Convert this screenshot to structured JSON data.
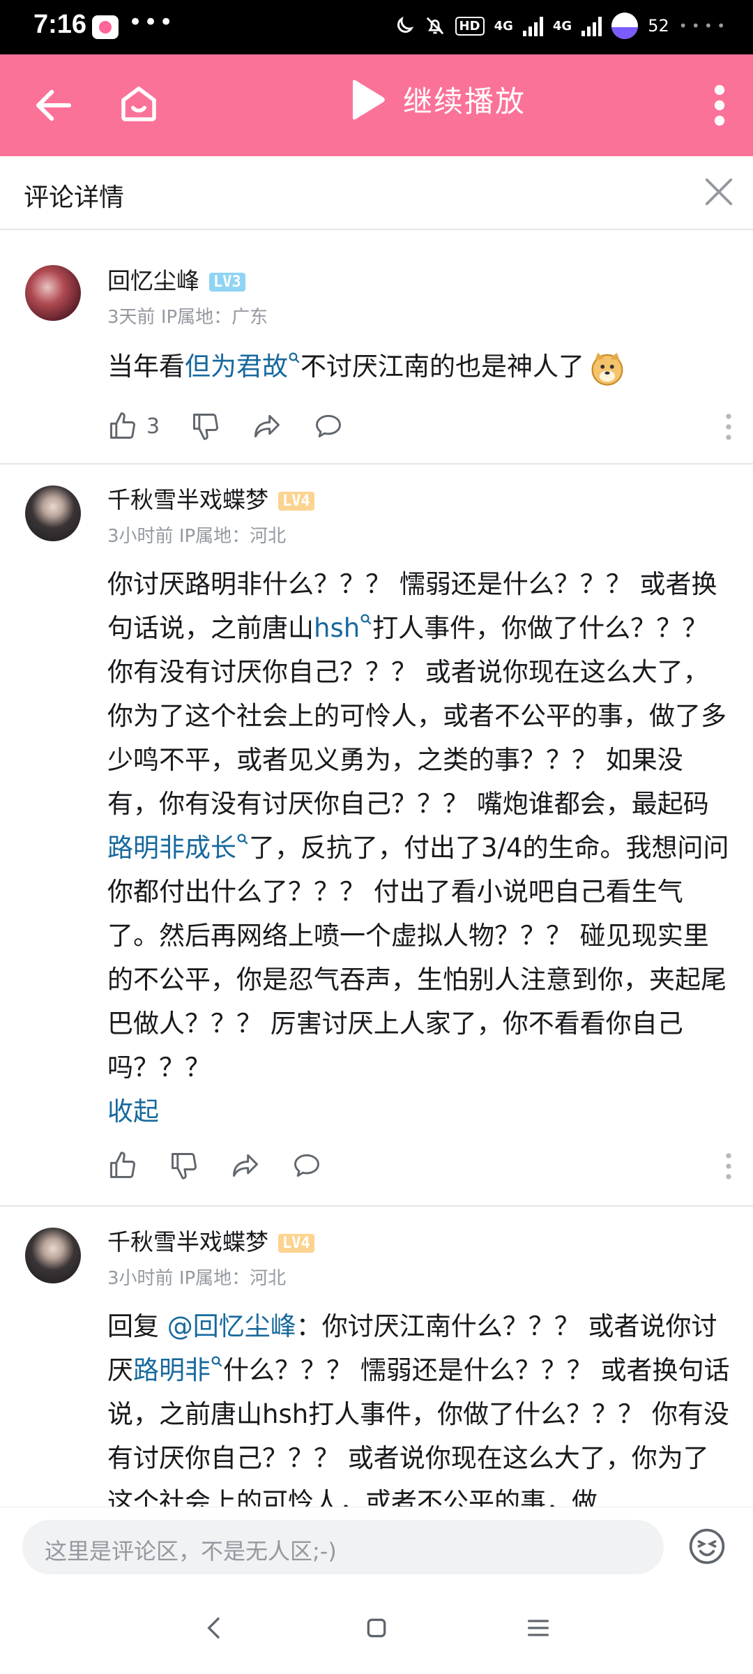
{
  "status": {
    "time": "7:16",
    "more": "•••",
    "net1": "4G",
    "net2": "4G",
    "battery": "52"
  },
  "topbar": {
    "play_label": "继续播放"
  },
  "panel": {
    "title": "评论详情"
  },
  "comments": [
    {
      "user": "回忆尘峰",
      "level": "LV3",
      "time": "3天前",
      "ip": "IP属地：广东",
      "text_before": "当年看",
      "link": "但为君故",
      "text_after": "不讨厌江南的也是神人了",
      "likes": "3"
    },
    {
      "user": "千秋雪半戏蝶梦",
      "level": "LV4",
      "time": "3小时前",
      "ip": "IP属地：河北",
      "p1": "你讨厌路明非什么？？？ 懦弱还是什么？？？ 或者换句话说，之前唐山",
      "link1": "hsh",
      "p2": "打人事件，你做了什么？？？ 你有没有讨厌你自己？？？ 或者说你现在这么大了，你为了这个社会上的可怜人，或者不公平的事，做了多少鸣不平，或者见义勇为，之类的事？？？ 如果没有，你有没有讨厌你自己？？？ 嘴炮谁都会，最起码",
      "link2": "路明非成长",
      "p3": "了，反抗了，付出了3/4的生命。我想问问你都付出什么了？？？ 付出了看小说吧自己看生气了。然后再网络上喷一个虚拟人物？？？ 碰见现实里的不公平，你是忍气吞声，生怕别人注意到你，夹起尾巴做人？？？ 厉害讨厌上人家了，你不看看你自己吗？？？",
      "collapse": "收起"
    },
    {
      "user": "千秋雪半戏蝶梦",
      "level": "LV4",
      "time": "3小时前",
      "ip": "IP属地：河北",
      "reply_prefix": "回复 ",
      "mention": "@回忆尘峰",
      "p1": "：你讨厌江南什么？？？ 或者说你讨厌",
      "link1": "路明非",
      "p2": "什么？？？ 懦弱还是什么？？？ 或者换句话说，之前唐山hsh打人事件，你做了什么？？？ 你有没有讨厌你自己？？？ 或者说你现在这么大了，你为了这个社会上的可怜人，或者不公平的事，做"
    }
  ],
  "composer": {
    "placeholder": "这里是评论区，不是无人区;-)"
  },
  "colors": {
    "brand_pink": "#fb7299",
    "link_blue": "#17699d"
  }
}
